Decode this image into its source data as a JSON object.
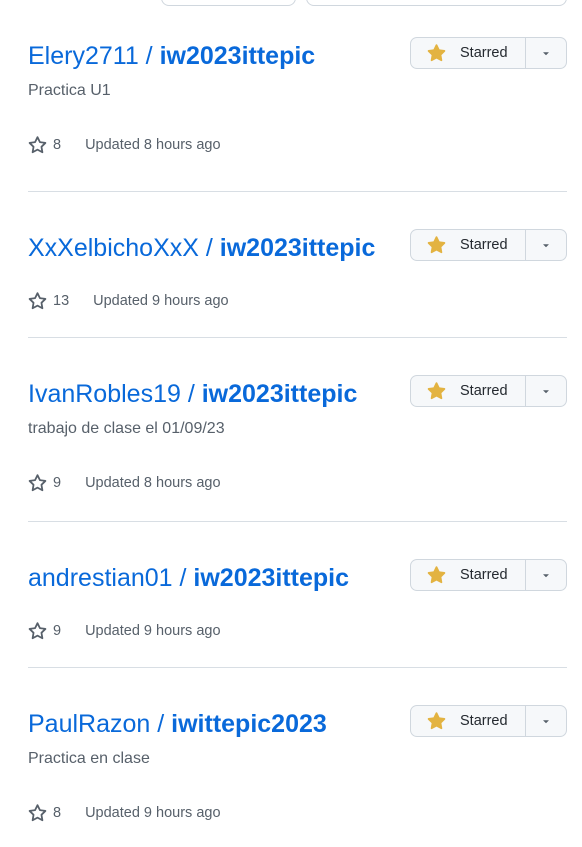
{
  "starred_label": "Starred",
  "colors": {
    "link": "#0969da",
    "muted": "#57606a",
    "star_fill": "#e3b341",
    "border": "#d0d7de"
  },
  "icons": {
    "star_outline": "star-icon",
    "star_filled": "star-fill-icon",
    "dropdown": "triangle-down-icon"
  },
  "repos": [
    {
      "owner": "Elery2711",
      "name": "iw2023ittepic",
      "description": "Practica U1",
      "stars": "8",
      "updated": "Updated 8 hours ago"
    },
    {
      "owner": "XxXelbichoXxX",
      "name": "iw2023ittepic",
      "description": "",
      "stars": "13",
      "updated": "Updated 9 hours ago"
    },
    {
      "owner": "IvanRobles19",
      "name": "iw2023ittepic",
      "description": "trabajo de clase el 01/09/23",
      "stars": "9",
      "updated": "Updated 8 hours ago"
    },
    {
      "owner": "andrestian01",
      "name": "iw2023ittepic",
      "description": "",
      "stars": "9",
      "updated": "Updated 9 hours ago"
    },
    {
      "owner": "PaulRazon",
      "name": "iwittepic2023",
      "description": "Practica en clase",
      "stars": "8",
      "updated": "Updated 9 hours ago"
    }
  ]
}
